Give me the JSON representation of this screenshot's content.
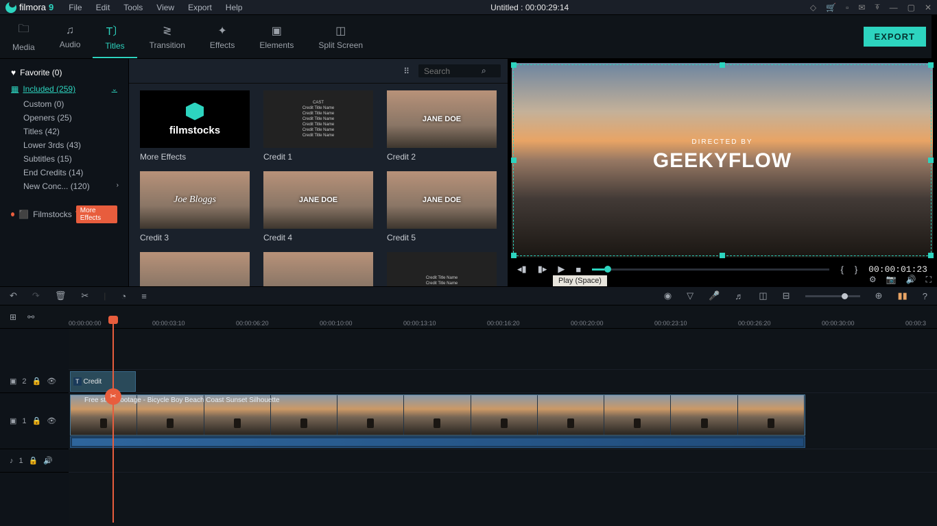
{
  "app": {
    "name": "filmora",
    "ver": "9",
    "title": "Untitled : 00:00:29:14"
  },
  "menu": {
    "file": "File",
    "edit": "Edit",
    "tools": "Tools",
    "view": "View",
    "export": "Export",
    "help": "Help"
  },
  "tabs": {
    "media": "Media",
    "audio": "Audio",
    "titles": "Titles",
    "transition": "Transition",
    "effects": "Effects",
    "elements": "Elements",
    "split": "Split Screen",
    "export_btn": "EXPORT"
  },
  "sidebar": {
    "favorite": "Favorite (0)",
    "included": "Included (259)",
    "items": [
      "Custom (0)",
      "Openers (25)",
      "Titles (42)",
      "Lower 3rds (43)",
      "Subtitles (15)",
      "End Credits (14)",
      "New Conc... (120)"
    ],
    "filmstocks": "Filmstocks",
    "more_effects": "More Effects"
  },
  "gallery": {
    "search_ph": "Search",
    "filmstocks": "filmstocks",
    "items": [
      {
        "label": "More Effects"
      },
      {
        "label": "Credit 1"
      },
      {
        "label": "Credit 2",
        "name": "JANE DOE"
      },
      {
        "label": "Credit 3",
        "name": "Joe Bloggs"
      },
      {
        "label": "Credit 4",
        "name": "JANE DOE"
      },
      {
        "label": "Credit 5",
        "name": "JANE DOE"
      }
    ]
  },
  "preview": {
    "subtitle": "DIRECTED BY",
    "title": "GEEKYFLOW",
    "time": "00:00:01:23",
    "tooltip": "Play (Space)"
  },
  "ruler": {
    "times": [
      "00:00:00:00",
      "00:00:03:10",
      "00:00:06:20",
      "00:00:10:00",
      "00:00:13:10",
      "00:00:16:20",
      "00:00:20:00",
      "00:00:23:10",
      "00:00:26:20",
      "00:00:30:00",
      "00:00:3"
    ]
  },
  "tracks": {
    "t2": "2",
    "t1": "1",
    "a1": "1",
    "title_clip": "Credit",
    "video_clip": "Free stock footage - Bicycle Boy Beach Coast Sunset Silhouette"
  }
}
